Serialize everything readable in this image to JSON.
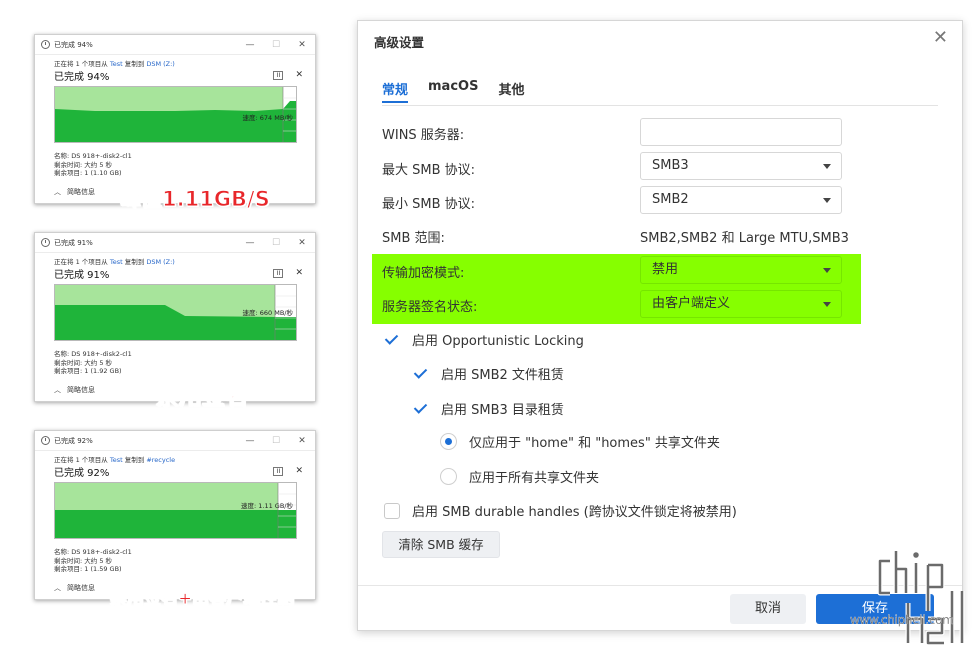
{
  "copy_dialogs": [
    {
      "title": "已完成 94%",
      "line1_prefix": "正在将 1 个项目从",
      "source": "Test",
      "line1_mid": "复制到",
      "dest": "DSM (Z:)",
      "percent": "已完成 94%",
      "pause": "II",
      "close": "✕",
      "speed": "速度: 674 MB/秒",
      "name": "名称: DS 918+-disk2-cl1",
      "time_left": "剩余时间: 大约 5 秒",
      "items_left": "剩余项目: 1 (1.10 GB)",
      "details": "简略信息",
      "overlay": "峰值1.11GB/S",
      "progress": 0.94
    },
    {
      "title": "已完成 91%",
      "line1_prefix": "正在将 1 个项目从",
      "source": "Test",
      "line1_mid": "复制到",
      "dest": "DSM (Z:)",
      "percent": "已完成 91%",
      "pause": "II",
      "close": "✕",
      "speed": "速度: 660 MB/秒",
      "name": "名称: DS 918+-disk2-cl1",
      "time_left": "剩余时间: 大约 5 秒",
      "items_left": "剩余项目: 1 (1.92 GB)",
      "details": "简略信息",
      "overlay": "禁用签名",
      "progress": 0.91
    },
    {
      "title": "已完成 92%",
      "line1_prefix": "正在将 1 个项目从",
      "source": "Test",
      "line1_mid": "复制到",
      "dest": "#recycle",
      "percent": "已完成 92%",
      "pause": "II",
      "close": "✕",
      "speed": "速度: 1.11 GB/秒",
      "name": "名称: DS 918+-disk2-cl1",
      "time_left": "剩余时间: 大约 5 秒",
      "items_left": "剩余项目: 1 (1.59 GB)",
      "details": "简略信息",
      "overlay": "禁用签名+由客户端控制",
      "progress": 0.92
    }
  ],
  "window_controls": {
    "minimize": "—",
    "maximize": "☐",
    "close": "✕"
  },
  "dialog": {
    "title": "高级设置",
    "close": "✕",
    "tabs": [
      "常规",
      "macOS",
      "其他"
    ],
    "rows": {
      "wins_label": "WINS 服务器:",
      "wins_value": "",
      "max_smb_label": "最大 SMB 协议:",
      "max_smb_value": "SMB3",
      "min_smb_label": "最小 SMB 协议:",
      "min_smb_value": "SMB2",
      "range_label": "SMB 范围:",
      "range_value": "SMB2,SMB2 和 Large MTU,SMB3",
      "encrypt_label": "传输加密模式:",
      "encrypt_value": "禁用",
      "sign_label": "服务器签名状态:",
      "sign_value": "由客户端定义"
    },
    "checks": {
      "oplock": "启用 Opportunistic Locking",
      "smb2_lease": "启用 SMB2 文件租赁",
      "smb3_lease": "启用 SMB3 目录租赁",
      "radio_home": "仅应用于 \"home\" 和 \"homes\" 共享文件夹",
      "radio_all": "应用于所有共享文件夹",
      "durable": "启用 SMB durable handles (跨协议文件锁定将被禁用)"
    },
    "clear_cache": "清除 SMB 缓存",
    "cancel": "取消",
    "save": "保存"
  },
  "watermark": {
    "url": "www.chiphell.com"
  },
  "colors": {
    "accent": "#1d6fd6",
    "highlight": "#86ff00",
    "overlay_red": "#e8262a",
    "graph_green": "#1fb43a"
  }
}
